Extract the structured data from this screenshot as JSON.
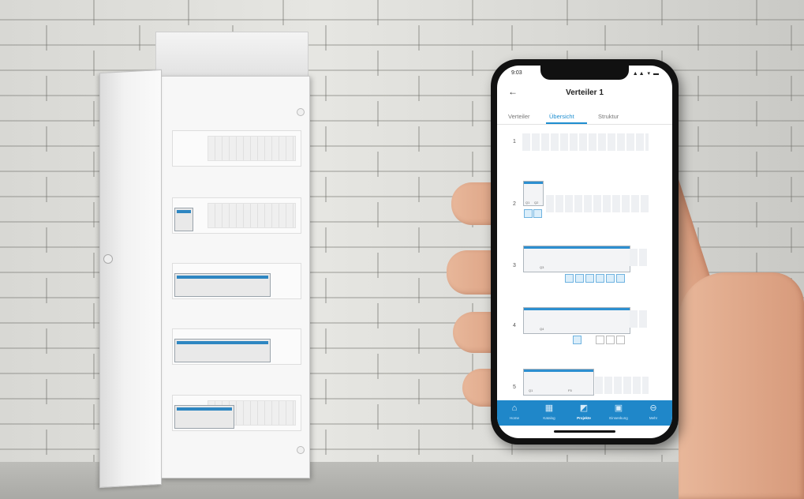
{
  "phone": {
    "status_time": "9:03",
    "status_icons": "▲▲ ▾ ▬",
    "title": "Verteiler 1",
    "tabs": [
      {
        "label": "Verteiler",
        "active": false
      },
      {
        "label": "Übersicht",
        "active": true
      },
      {
        "label": "Struktur",
        "active": false
      }
    ],
    "rows": [
      "1",
      "2",
      "3",
      "4",
      "5"
    ],
    "devices": {
      "row2_a": "Q1",
      "row2_b": "Q2",
      "row3_main": "Q3",
      "row4_main": "Q4",
      "row5_main": "Q1",
      "row5_b": "F5"
    },
    "bottom_nav": [
      {
        "label": "Home",
        "icon": "home-icon",
        "active": false
      },
      {
        "label": "Katalog",
        "icon": "catalog-icon",
        "active": false
      },
      {
        "label": "Projekte",
        "icon": "projects-icon",
        "active": true
      },
      {
        "label": "Einsenkung",
        "icon": "installation-icon",
        "active": false
      },
      {
        "label": "Mehr",
        "icon": "more-icon",
        "active": false
      }
    ]
  },
  "colors": {
    "accent": "#1e8ed0",
    "nav_background": "#1f87c9"
  }
}
